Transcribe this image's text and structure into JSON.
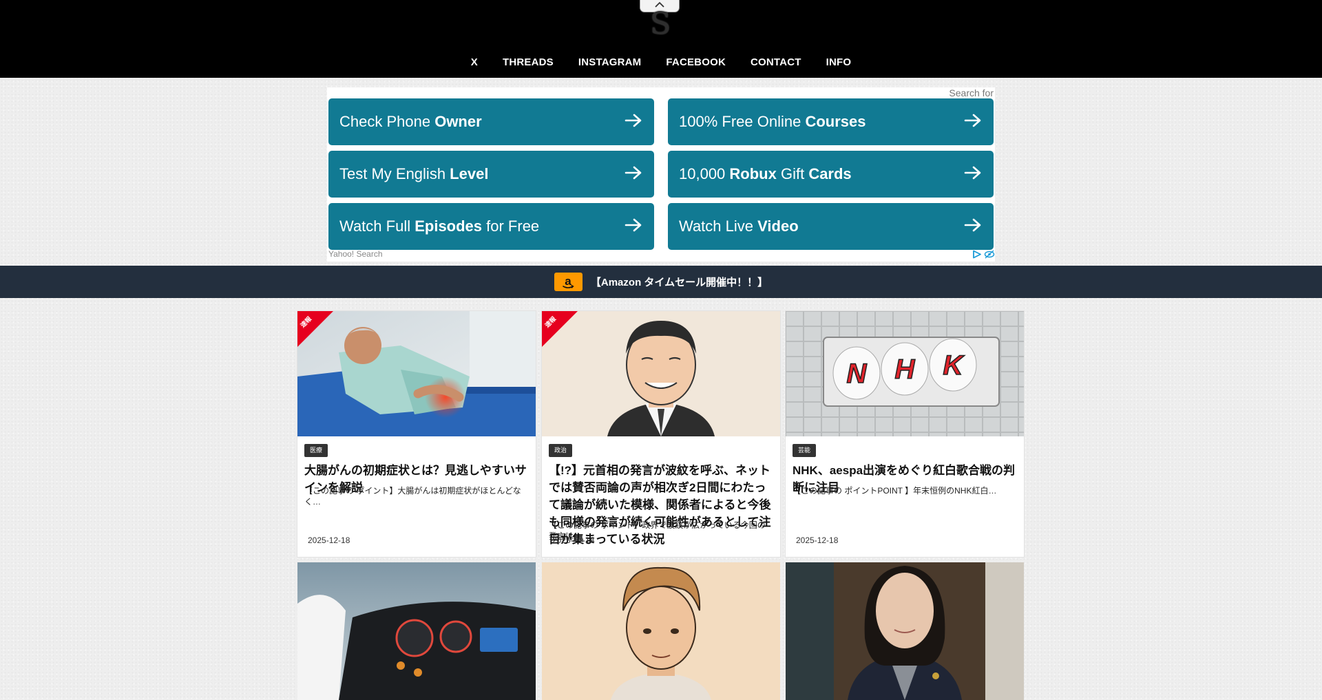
{
  "header": {
    "collapse_icon": "chevron-up-icon",
    "logo_text": "S",
    "nav": [
      {
        "label": "X"
      },
      {
        "label": "THREADS"
      },
      {
        "label": "INSTAGRAM"
      },
      {
        "label": "FACEBOOK"
      },
      {
        "label": "CONTACT"
      },
      {
        "label": "INFO"
      }
    ]
  },
  "ad": {
    "search_for": "Search for",
    "footer": "Yahoo! Search",
    "buttons": [
      {
        "parts": [
          {
            "text": "Check Phone ",
            "bold": false
          },
          {
            "text": "Owner",
            "bold": true
          }
        ]
      },
      {
        "parts": [
          {
            "text": "100% Free Online ",
            "bold": false
          },
          {
            "text": "Courses",
            "bold": true
          }
        ]
      },
      {
        "parts": [
          {
            "text": "Test My English ",
            "bold": false
          },
          {
            "text": "Level",
            "bold": true
          }
        ]
      },
      {
        "parts": [
          {
            "text": "10,000 ",
            "bold": false
          },
          {
            "text": "Robux",
            "bold": true
          },
          {
            "text": " Gift ",
            "bold": false
          },
          {
            "text": "Cards",
            "bold": true
          }
        ]
      },
      {
        "parts": [
          {
            "text": "Watch Full ",
            "bold": false
          },
          {
            "text": "Episodes",
            "bold": true
          },
          {
            "text": " for Free",
            "bold": false
          }
        ]
      },
      {
        "parts": [
          {
            "text": "Watch Live ",
            "bold": false
          },
          {
            "text": "Video",
            "bold": true
          }
        ]
      }
    ],
    "button_color": "#117a93",
    "icons": [
      "adchoices-play-icon",
      "adchoices-eye-icon"
    ]
  },
  "amazon_banner": {
    "text": "【Amazon タイムセール開催中！！】",
    "color": "#232f3e",
    "logo_color": "#ff9900"
  },
  "articles": [
    {
      "ribbon": "速報",
      "category": "医療",
      "title": "大腸がんの初期症状とは？見逃しやすいサインを解説",
      "excerpt": "【この記事の ポイント】大腸がんは初期症状がほとんどなく…",
      "date": "2025-12-18",
      "image": "hospital-patient-image"
    },
    {
      "ribbon": "速報",
      "category": "政治",
      "title": "【!?】元首相の発言が波紋を呼ぶ、ネットでは賛否両論の声が相次ぎ2日間にわたって議論が続いた模様、関係者によると今後も同様の発言が続く可能性があるとして注目が集まっている状況",
      "excerpt": "【この記事の ポイント】政界で波紋が広がっている今回の発言は…",
      "date": "2025-12-18",
      "image": "politician-illustration-image"
    },
    {
      "ribbon": "",
      "category": "芸能",
      "title": "NHK、aespa出演をめぐり紅白歌合戦の判断に注目",
      "excerpt": "【この記事の ポイントPOINT 】年末恒例のNHK紅白…",
      "date": "2025-12-18",
      "image": "nhk-sign-image"
    }
  ],
  "lower_cards": [
    {
      "image": "car-dashboard-image"
    },
    {
      "image": "young-man-illustration-image"
    },
    {
      "image": "woman-in-suit-image"
    }
  ]
}
